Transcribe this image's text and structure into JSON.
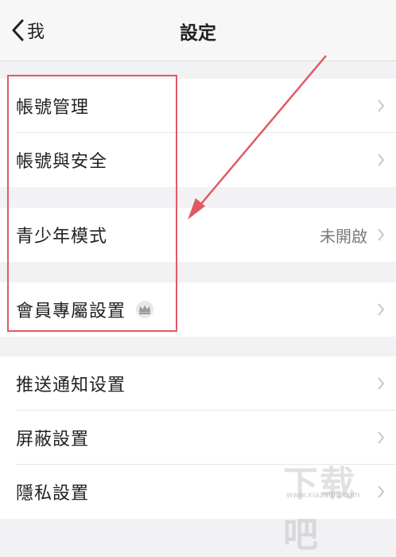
{
  "nav": {
    "back_label": "我",
    "title": "設定"
  },
  "sections": [
    {
      "items": [
        {
          "label": "帳號管理"
        },
        {
          "label": "帳號與安全"
        }
      ]
    },
    {
      "items": [
        {
          "label": "青少年模式",
          "value": "未開啟"
        }
      ]
    },
    {
      "items": [
        {
          "label": "會員專屬設置",
          "badge_icon": "crown-icon"
        }
      ]
    },
    {
      "items": [
        {
          "label": "推送通知设置"
        },
        {
          "label": "屏蔽設置"
        },
        {
          "label": "隱私設置"
        }
      ]
    }
  ],
  "watermark": {
    "text": "下载吧",
    "url": "www.xiazaiba.com"
  },
  "colors": {
    "highlight": "#e05a64",
    "background": "#f2f2f4",
    "chevron": "#c7c7cc"
  }
}
